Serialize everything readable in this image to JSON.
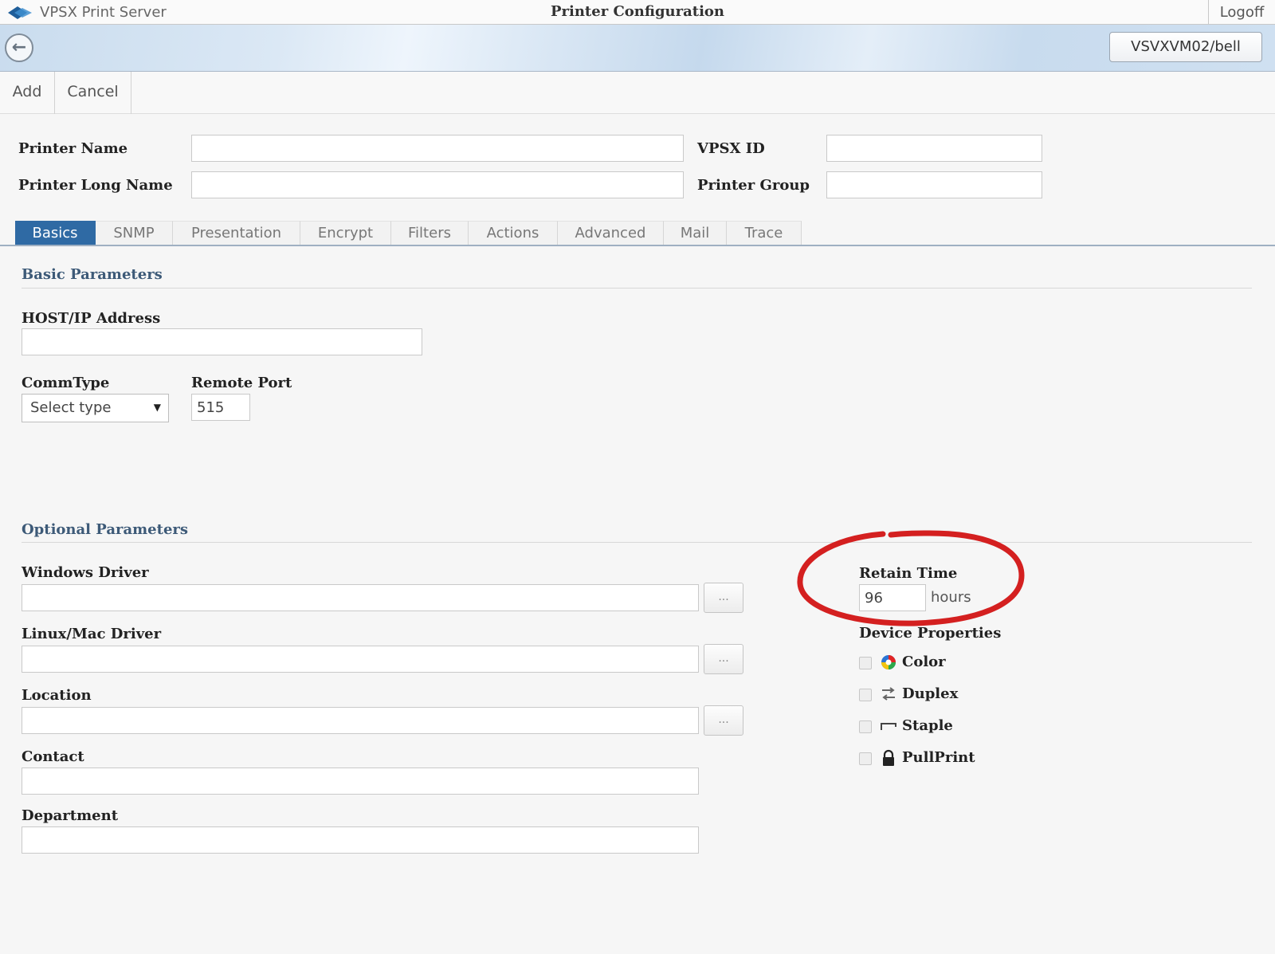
{
  "app": {
    "name": "VPSX Print Server",
    "window_title": "Printer Configuration",
    "logoff_label": "Logoff"
  },
  "server": {
    "label": "VSVXVM02/bell"
  },
  "actions": {
    "add_label": "Add",
    "cancel_label": "Cancel"
  },
  "header_fields": {
    "printer_name": {
      "label": "Printer Name",
      "value": ""
    },
    "printer_long_name": {
      "label": "Printer Long Name",
      "value": ""
    },
    "vpsx_id": {
      "label": "VPSX ID",
      "value": ""
    },
    "printer_group": {
      "label": "Printer Group",
      "value": ""
    }
  },
  "tabs": [
    {
      "label": "Basics",
      "active": true
    },
    {
      "label": "SNMP"
    },
    {
      "label": "Presentation"
    },
    {
      "label": "Encrypt"
    },
    {
      "label": "Filters"
    },
    {
      "label": "Actions"
    },
    {
      "label": "Advanced"
    },
    {
      "label": "Mail"
    },
    {
      "label": "Trace"
    }
  ],
  "basic": {
    "title": "Basic Parameters",
    "host": {
      "label": "HOST/IP Address",
      "value": ""
    },
    "commtype": {
      "label": "CommType",
      "selected": "Select type"
    },
    "remote_port": {
      "label": "Remote Port",
      "value": "515"
    }
  },
  "optional": {
    "title": "Optional Parameters",
    "windows_driver": {
      "label": "Windows Driver",
      "value": "",
      "browse_label": "..."
    },
    "linux_driver": {
      "label": "Linux/Mac Driver",
      "value": "",
      "browse_label": "..."
    },
    "location": {
      "label": "Location",
      "value": "",
      "browse_label": "..."
    },
    "contact": {
      "label": "Contact",
      "value": ""
    },
    "department": {
      "label": "Department",
      "value": ""
    },
    "retain_time": {
      "label": "Retain Time",
      "value": "96",
      "unit": "hours"
    },
    "device_properties": {
      "title": "Device Properties",
      "items": [
        {
          "label": "Color",
          "icon": "color-wheel-icon",
          "checked": false
        },
        {
          "label": "Duplex",
          "icon": "duplex-icon",
          "checked": false
        },
        {
          "label": "Staple",
          "icon": "staple-icon",
          "checked": false
        },
        {
          "label": "PullPrint",
          "icon": "lock-icon",
          "checked": false
        }
      ]
    }
  },
  "colors": {
    "accent": "#2f6aa4",
    "section_title": "#3d5a78",
    "highlight_ring": "#d42020"
  }
}
